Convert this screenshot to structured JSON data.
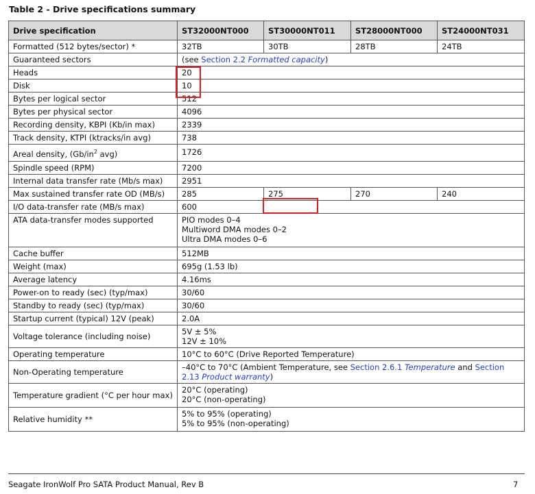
{
  "title": "Table 2 - Drive specifications summary",
  "headers": [
    "Drive specification",
    "ST32000NT000",
    "ST30000NT011",
    "ST28000NT000",
    "ST24000NT031"
  ],
  "rows": {
    "formatted": {
      "label": "Formatted (512 bytes/sector) *",
      "values": [
        "32TB",
        "30TB",
        "28TB",
        "24TB"
      ]
    },
    "guaranteed": {
      "label": "Guaranteed sectors",
      "pre": "(see ",
      "link": "Section 2.2",
      "link_italic": "Formatted capacity",
      "post": ")"
    },
    "heads": {
      "label": "Heads",
      "value": "20"
    },
    "disk": {
      "label": "Disk",
      "value": "10"
    },
    "bytes_logical": {
      "label": "Bytes per logical sector",
      "value": "512"
    },
    "bytes_physical": {
      "label": "Bytes per physical sector",
      "value": "4096"
    },
    "recording": {
      "label": "Recording density, KBPI (Kb/in max)",
      "value": "2339"
    },
    "track": {
      "label": "Track density, KTPI (ktracks/in avg)",
      "value": "738"
    },
    "areal": {
      "label_pre": "Areal density, (Gb/in",
      "label_sup": "2",
      "label_post": " avg)",
      "value": "1726"
    },
    "spindle": {
      "label": "Spindle speed (RPM)",
      "value": "7200"
    },
    "internal": {
      "label": "Internal data transfer rate (Mb/s max)",
      "value": "2951"
    },
    "max_sustained": {
      "label": "Max sustained transfer rate OD (MB/s)",
      "values": [
        "285",
        "275",
        "270",
        "240"
      ]
    },
    "io_rate": {
      "label": "I/O data-transfer rate (MB/s max)",
      "value": "600"
    },
    "ata": {
      "label": "ATA data-transfer modes supported",
      "lines": [
        "PIO modes 0–4",
        "Multiword DMA modes 0–2",
        "Ultra DMA modes 0–6"
      ]
    },
    "cache": {
      "label": "Cache buffer",
      "value": "512MB"
    },
    "weight": {
      "label": "Weight (max)",
      "value": "695g (1.53 lb)"
    },
    "latency": {
      "label": "Average latency",
      "value": "4.16ms"
    },
    "power_on": {
      "label": "Power-on to ready (sec) (typ/max)",
      "value": "30/60"
    },
    "standby": {
      "label": "Standby to ready (sec) (typ/max)",
      "value": "30/60"
    },
    "startup": {
      "label": "Startup current (typical) 12V (peak)",
      "value": "2.0A"
    },
    "voltage": {
      "label": "Voltage tolerance (including noise)",
      "lines": [
        "5V ± 5%",
        "12V ± 10%"
      ]
    },
    "op_temp": {
      "label": "Operating temperature",
      "value": "10°C to 60°C (Drive Reported Temperature)"
    },
    "nonop_temp": {
      "label": "Non-Operating temperature",
      "pre": "–40°C to 70°C (Ambient Temperature, see ",
      "link1": "Section 2.6.1",
      "link1_italic": "Temperature",
      "mid": " and ",
      "link2": "Section 2.13",
      "link2_italic": "Product warranty",
      "post": ")"
    },
    "gradient": {
      "label": "Temperature gradient (°C per hour max)",
      "lines": [
        "20°C (operating)",
        "20°C (non-operating)"
      ]
    },
    "humidity": {
      "label": "Relative humidity **",
      "lines": [
        "5% to 95% (operating)",
        "5% to 95% (non-operating)"
      ]
    }
  },
  "footer": {
    "left": "Seagate IronWolf Pro SATA Product Manual, Rev B",
    "page": "7"
  },
  "colors": {
    "header_bg": "#d9d9d9",
    "link": "#1f3fcf",
    "highlight": "#e0191f"
  }
}
